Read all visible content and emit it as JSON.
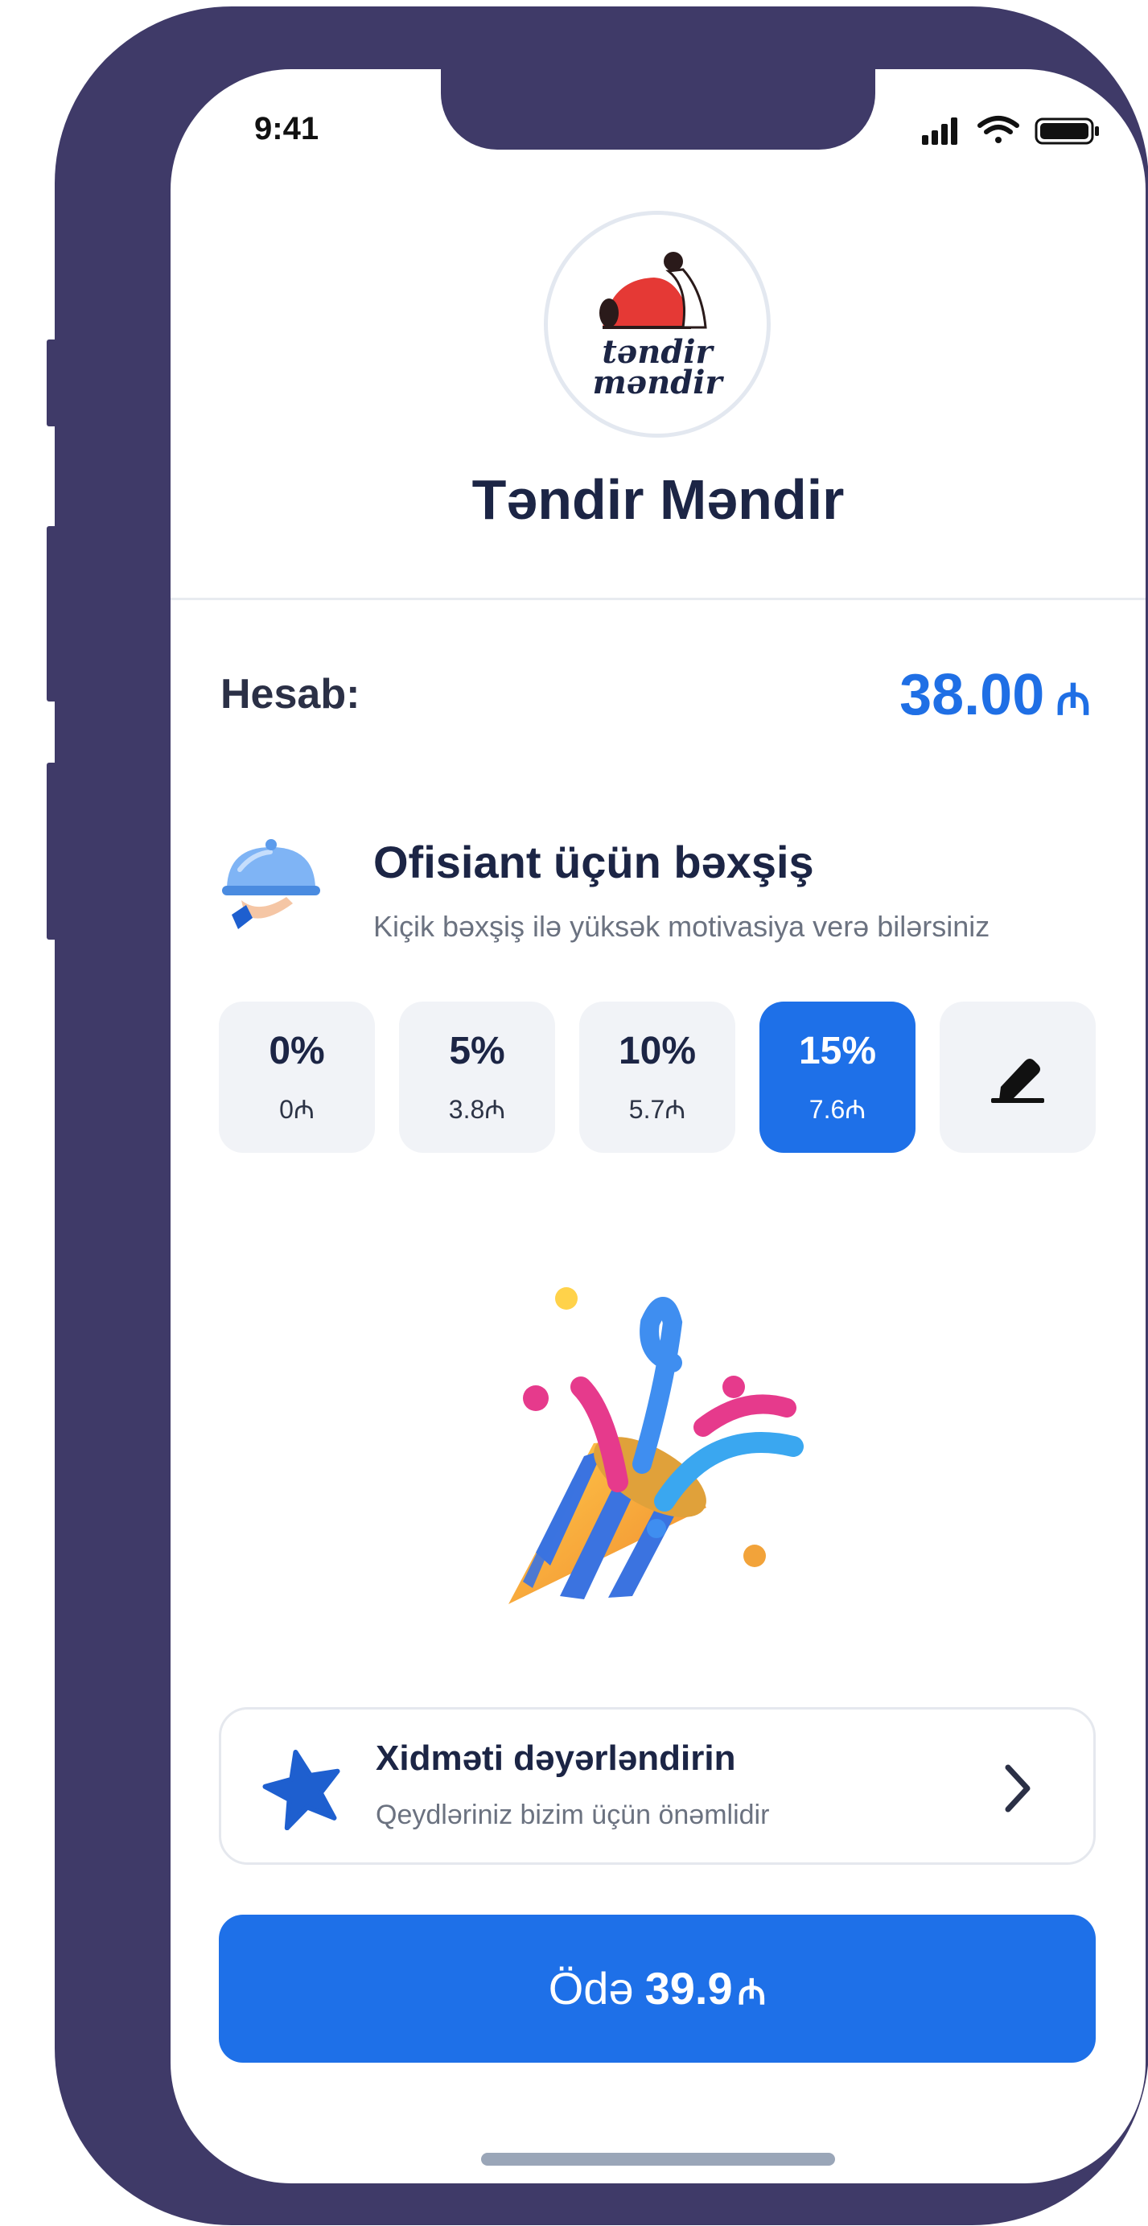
{
  "status_bar": {
    "time": "9:41"
  },
  "restaurant": {
    "name": "Təndir Məndir",
    "logo_text": [
      "təndir",
      "məndir"
    ]
  },
  "bill": {
    "label": "Hesab:",
    "amount": "38.00",
    "currency_symbol": "₼"
  },
  "tip": {
    "title": "Ofisiant üçün bəxşiş",
    "subtitle": "Kiçik bəxşiş ilə yüksək motivasiya verə bilərsiniz",
    "options": [
      {
        "percent": "0%",
        "amount": "0₼",
        "selected": false
      },
      {
        "percent": "5%",
        "amount": "3.8₼",
        "selected": false
      },
      {
        "percent": "10%",
        "amount": "5.7₼",
        "selected": false
      },
      {
        "percent": "15%",
        "amount": "7.6₼",
        "selected": true
      }
    ],
    "custom_icon": "pencil-icon"
  },
  "review": {
    "title": "Xidməti dəyərləndirin",
    "subtitle": "Qeydləriniz bizim üçün önəmlidir",
    "icon": "star-icon"
  },
  "pay": {
    "label": "Ödə",
    "amount": "39.9",
    "currency_symbol": "₼"
  },
  "colors": {
    "frame": "#3f3a68",
    "primary": "#1e70e8",
    "text_dark": "#1c2545",
    "text_muted": "#6b7280",
    "chip_bg": "#f1f3f7"
  }
}
